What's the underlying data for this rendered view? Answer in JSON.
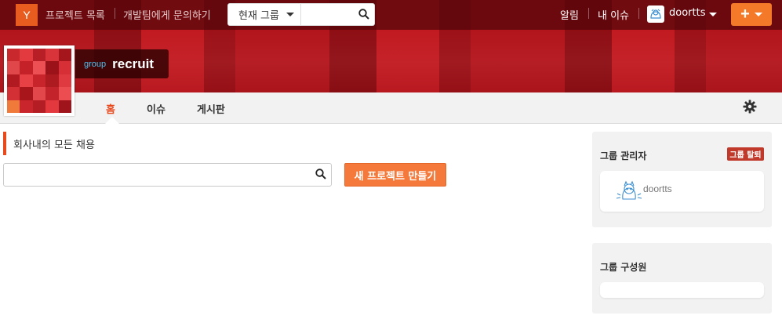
{
  "topbar": {
    "logo_letter": "Y",
    "project_list": "프로젝트 목록",
    "contact_dev": "개발팀에게 문의하기",
    "group_scope": "현재 그룹",
    "search_value": "",
    "notifications": "알림",
    "my_issues": "내 이슈",
    "username": "doortts",
    "plus": "+"
  },
  "group": {
    "tag": "group",
    "name": "recruit",
    "mosaic_colors": [
      "#c9282d",
      "#e23a3f",
      "#b81e25",
      "#d8343a",
      "#a4161c",
      "#e0474a",
      "#c42129",
      "#ec5055",
      "#9b1218",
      "#d62f35",
      "#b01a20",
      "#e84145",
      "#c7252b",
      "#ad1b21",
      "#df3a3f",
      "#d33035",
      "#a8151b",
      "#e2474b",
      "#c3232a",
      "#eb4d51",
      "#f07a3a",
      "#c8262c",
      "#b41d24",
      "#e3393e",
      "#9f141a"
    ]
  },
  "subnav": {
    "tabs": [
      {
        "label": "홈",
        "active": true
      },
      {
        "label": "이슈",
        "active": false
      },
      {
        "label": "게시판",
        "active": false
      }
    ]
  },
  "main": {
    "description": "회사내의 모든 채용",
    "search_placeholder": "",
    "new_project": "새 프로젝트 만들기"
  },
  "sidebar": {
    "admins_title": "그룹 관리자",
    "leave_label": "그룹 탈퇴",
    "admin_name": "doortts",
    "members_title": "그룹 구성원"
  },
  "colors": {
    "accent": "#e8491d",
    "button_orange": "#f4793a",
    "leave_red": "#c0392b",
    "group_tag_blue": "#4ec3f2"
  }
}
